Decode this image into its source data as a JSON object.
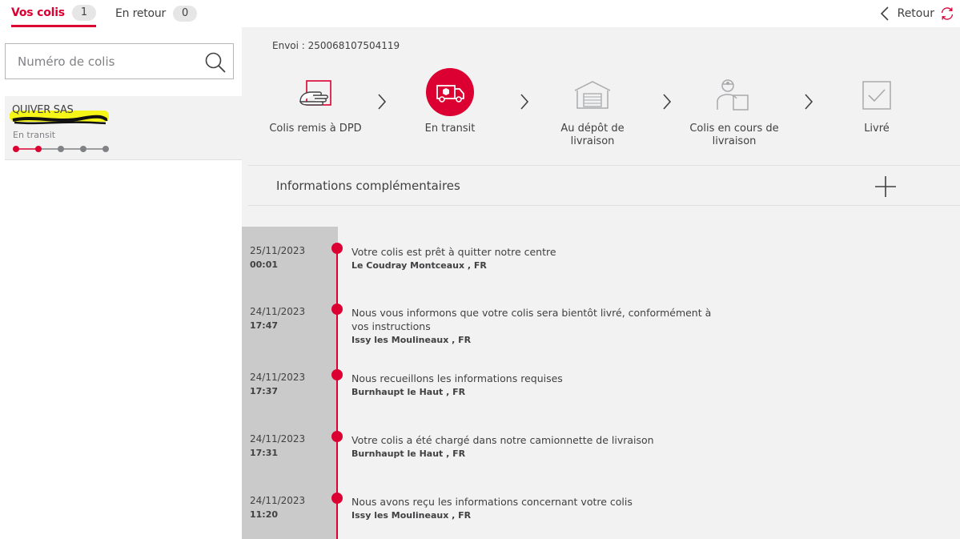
{
  "tabs": [
    {
      "label": "Vos colis",
      "count": "1"
    },
    {
      "label": "En retour",
      "count": "0"
    }
  ],
  "back": {
    "label": "Retour"
  },
  "search": {
    "placeholder": "Numéro de colis"
  },
  "parcel": {
    "name": "QUIVER SAS",
    "status": "En transit",
    "progress_steps_done": 2,
    "progress_steps_total": 5
  },
  "shipment": {
    "label": "Envoi : 250068107504119"
  },
  "steps": [
    {
      "label": "Colis remis à DPD",
      "icon": "hand-over-parcel-icon",
      "state": "done"
    },
    {
      "label": "En transit",
      "icon": "delivery-van-icon",
      "state": "active"
    },
    {
      "label": "Au dépôt de livraison",
      "icon": "depot-icon",
      "state": "pending"
    },
    {
      "label": "Colis en cours de livraison",
      "icon": "courier-icon",
      "state": "pending"
    },
    {
      "label": "Livré",
      "icon": "checkbox-icon",
      "state": "pending"
    }
  ],
  "info": {
    "label": "Informations complémentaires"
  },
  "events": [
    {
      "date": "25/11/2023",
      "time": "00:01",
      "text": "Votre colis est prêt à quitter notre centre",
      "location": "Le Coudray Montceaux , FR"
    },
    {
      "date": "24/11/2023",
      "time": "17:47",
      "text": "Nous vous informons que votre colis sera bientôt livré, conformément à vos instructions",
      "location": "Issy les Moulineaux , FR"
    },
    {
      "date": "24/11/2023",
      "time": "17:37",
      "text": "Nous recueillons les informations requises",
      "location": "Burnhaupt le Haut , FR"
    },
    {
      "date": "24/11/2023",
      "time": "17:31",
      "text": "Votre colis a été chargé dans notre camionnette de livraison",
      "location": "Burnhaupt le Haut , FR"
    },
    {
      "date": "24/11/2023",
      "time": "11:20",
      "text": "Nous avons reçu les informations concernant votre colis",
      "location": "Issy les Moulineaux , FR"
    }
  ],
  "colors": {
    "accent": "#dc0032",
    "inactive_dot": "#808285",
    "panel_bg": "#f2f2f2",
    "date_col_bg": "#cacaca"
  }
}
